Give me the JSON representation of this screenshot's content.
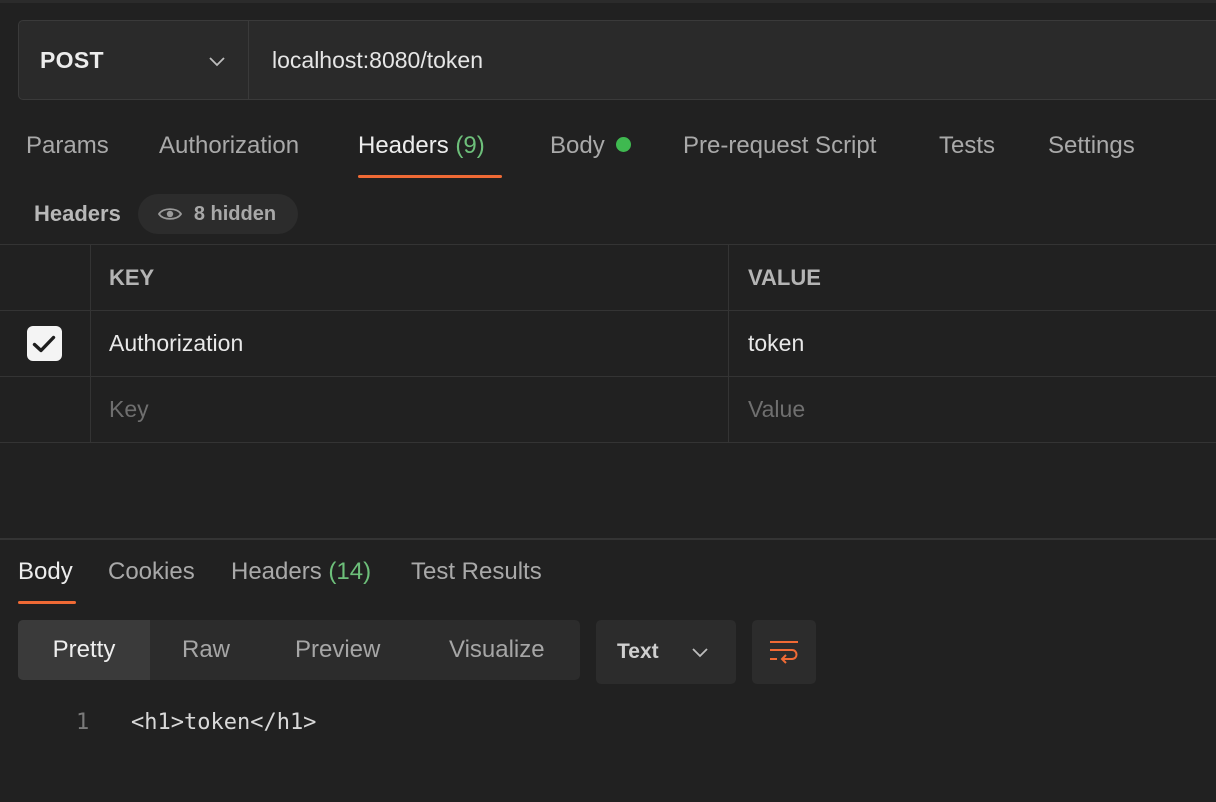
{
  "request": {
    "method": "POST",
    "url": "localhost:8080/token"
  },
  "request_tabs": [
    {
      "label": "Params"
    },
    {
      "label": "Authorization"
    },
    {
      "label": "Headers",
      "count": "(9)",
      "active": true
    },
    {
      "label": "Body",
      "indicator": "green-dot"
    },
    {
      "label": "Pre-request Script"
    },
    {
      "label": "Tests"
    },
    {
      "label": "Settings"
    }
  ],
  "headers_section": {
    "title": "Headers",
    "hidden_label": "8 hidden",
    "hidden_icon": "eye-icon",
    "columns": {
      "key": "KEY",
      "value": "VALUE"
    },
    "rows": [
      {
        "checked": true,
        "key": "Authorization",
        "value": "token"
      }
    ],
    "new_row": {
      "key_placeholder": "Key",
      "value_placeholder": "Value"
    }
  },
  "response_tabs": [
    {
      "label": "Body",
      "active": true
    },
    {
      "label": "Cookies"
    },
    {
      "label": "Headers",
      "count": "(14)"
    },
    {
      "label": "Test Results"
    }
  ],
  "response_view": {
    "modes": [
      "Pretty",
      "Raw",
      "Preview",
      "Visualize"
    ],
    "active_mode": "Pretty",
    "format": "Text",
    "wrap_icon": "wrap-lines-icon"
  },
  "response_body": [
    {
      "line": "1",
      "text": "<h1>token</h1>"
    }
  ],
  "colors": {
    "background": "#212121",
    "accent": "#f06a35",
    "count_green": "#6dbf7a",
    "dot_green": "#3fb950"
  }
}
